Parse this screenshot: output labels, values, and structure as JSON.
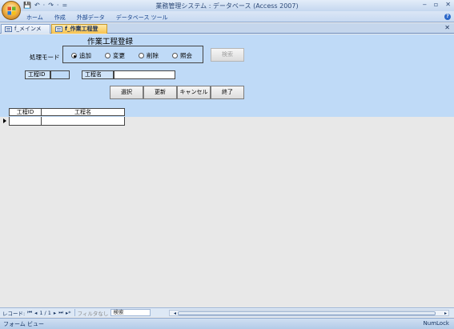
{
  "window": {
    "title": "業務管理システム : データベース (Access 2007)",
    "controls": [
      "‒",
      "▫",
      "✕"
    ]
  },
  "qat": {
    "items": [
      "💾",
      "↶",
      "·",
      "↷",
      "·",
      "="
    ]
  },
  "ribbon": {
    "tabs": [
      "ホーム",
      "作成",
      "外部データ",
      "データベース ツール"
    ]
  },
  "doc_tabs": [
    {
      "label": "f_メインメニュー",
      "active": false
    },
    {
      "label": "f_作業工程登録",
      "active": true
    }
  ],
  "form": {
    "title": "作業工程登録",
    "mode_label": "処理モード",
    "modes": [
      {
        "label": "追加",
        "selected": true
      },
      {
        "label": "変更",
        "selected": false
      },
      {
        "label": "削除",
        "selected": false
      },
      {
        "label": "照会",
        "selected": false
      }
    ],
    "search_button": "検索",
    "field_id_label": "工程ID",
    "field_id_value": "",
    "field_name_label": "工程名",
    "field_name_value": "",
    "buttons": {
      "select": "選択",
      "update": "更新",
      "cancel": "キャンセル",
      "exit": "終了"
    }
  },
  "grid": {
    "columns": [
      "工程ID",
      "工程名"
    ],
    "rows": [
      [
        "",
        ""
      ]
    ]
  },
  "record_nav": {
    "label": "レコード:",
    "first": "⏮",
    "prev": "◂",
    "position": "1 / 1",
    "next": "▸",
    "last": "⏭",
    "new": "▸*",
    "filter": "フィルタなし",
    "search_placeholder": "検索"
  },
  "status": {
    "left": "フォーム ビュー",
    "right": "NumLock"
  }
}
